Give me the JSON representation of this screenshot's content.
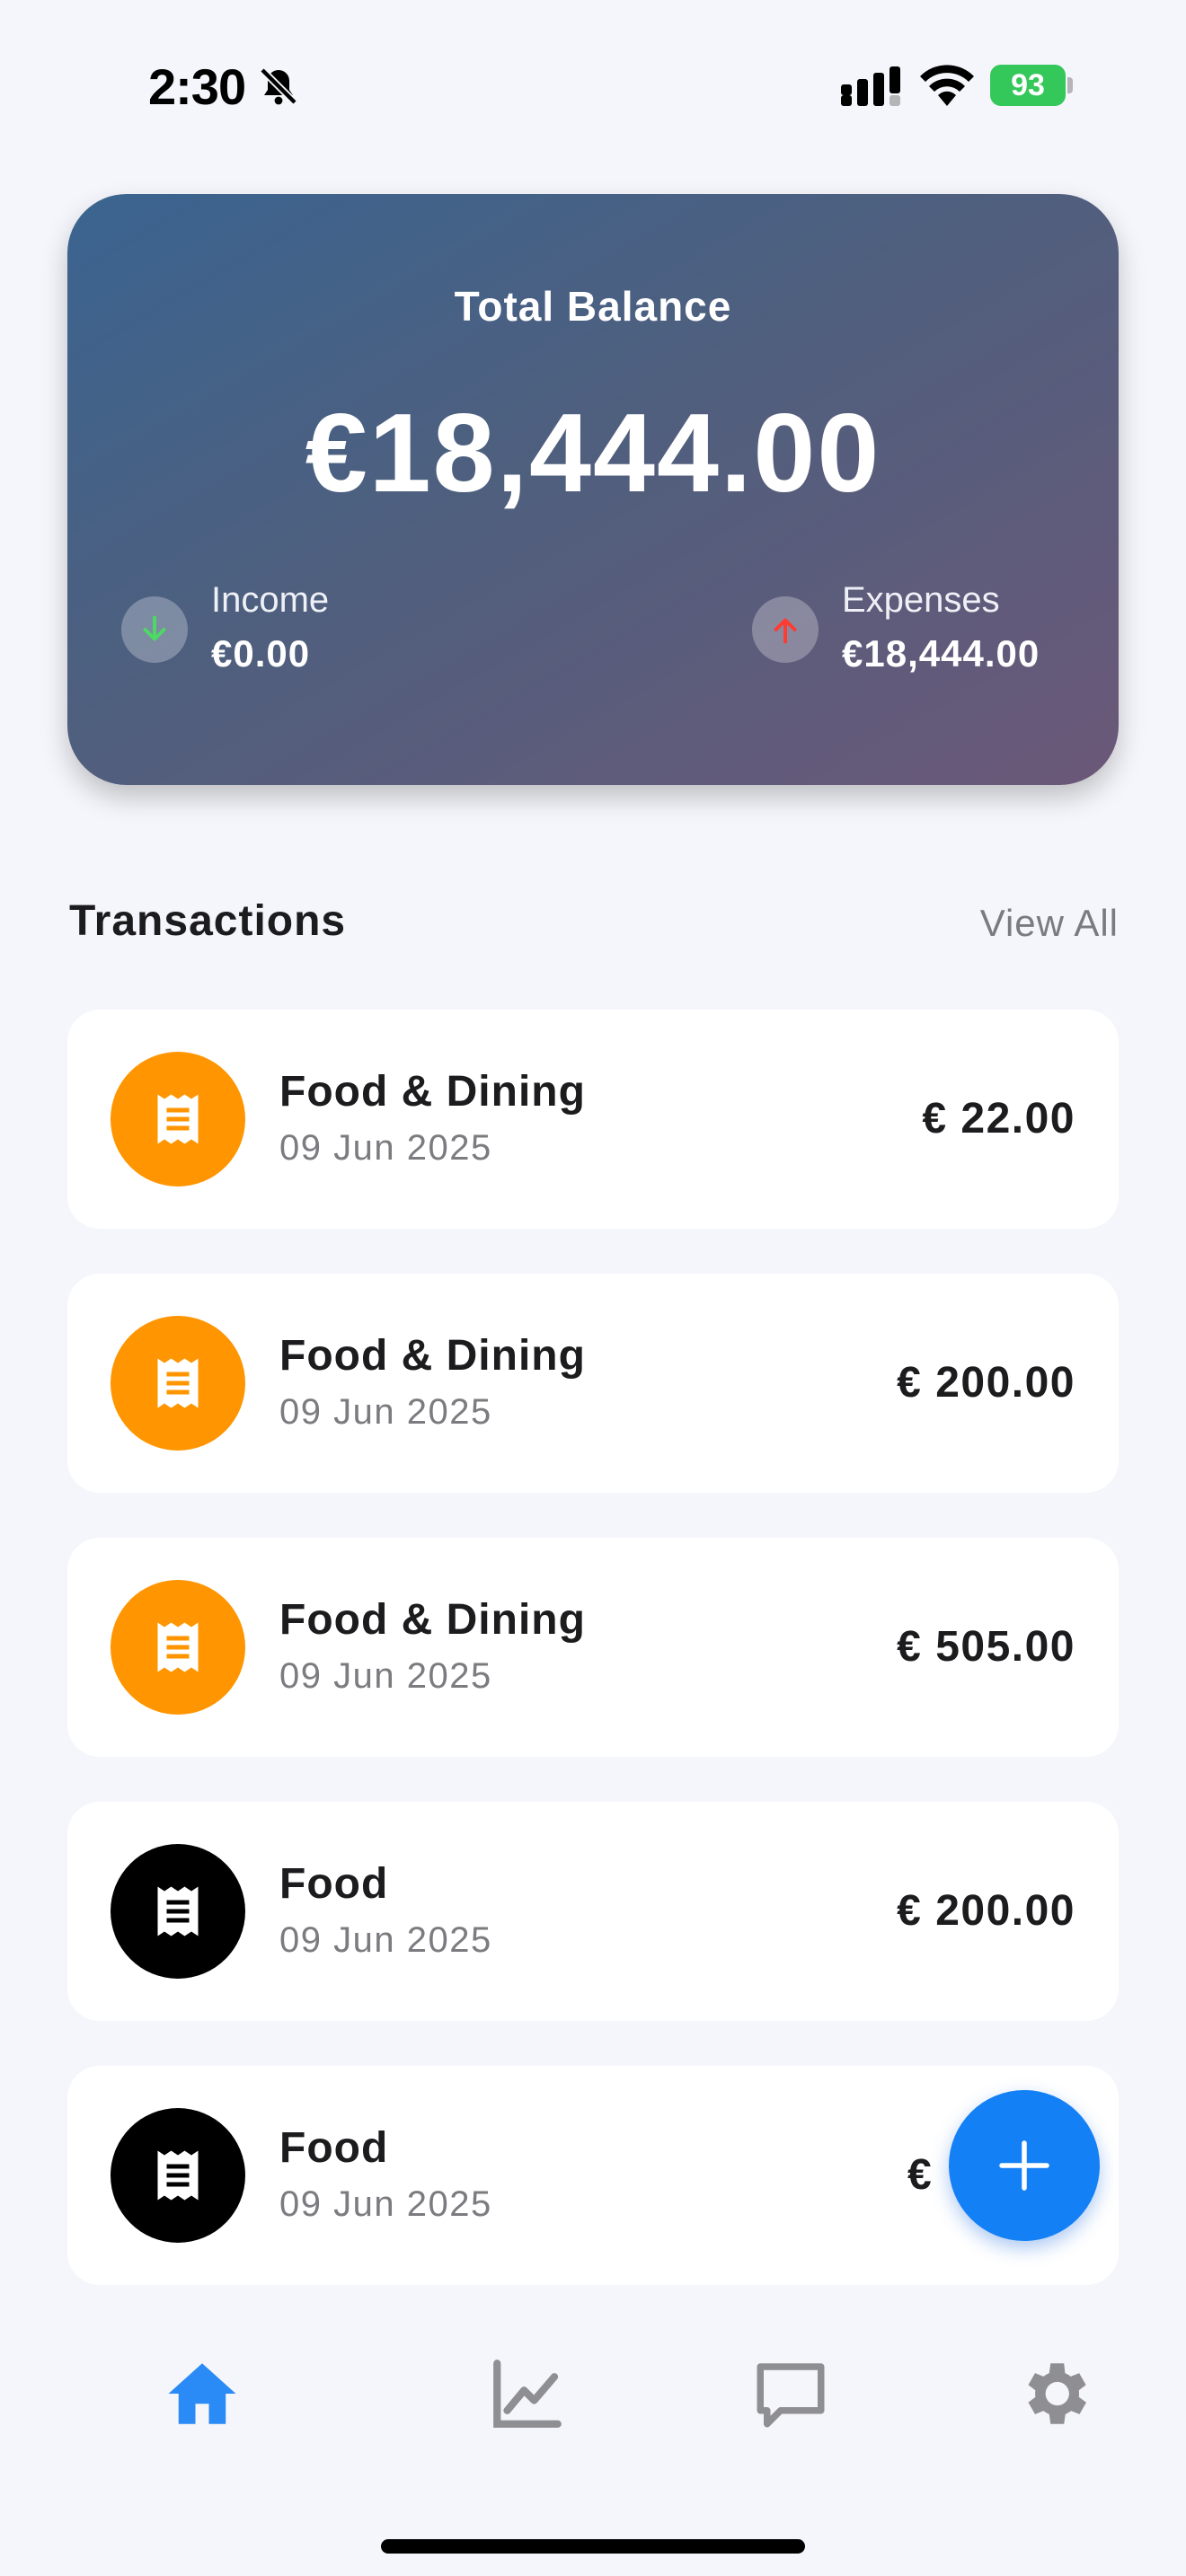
{
  "status_bar": {
    "time": "2:30",
    "battery": "93",
    "icons": [
      "bell-off-icon",
      "signal-icon",
      "wifi-icon",
      "battery-icon"
    ]
  },
  "balance_card": {
    "label": "Total Balance",
    "amount": "€18,444.00",
    "income": {
      "label": "Income",
      "value": "€0.00",
      "icon": "arrow-down-icon"
    },
    "expenses": {
      "label": "Expenses",
      "value": "€18,444.00",
      "icon": "arrow-up-icon"
    }
  },
  "transactions_section": {
    "title": "Transactions",
    "view_all": "View All"
  },
  "transactions": [
    {
      "name": "Food & Dining",
      "date": "09 Jun 2025",
      "amount": "€ 22.00",
      "icon": "receipt-icon",
      "icon_color": "#ff9500"
    },
    {
      "name": "Food & Dining",
      "date": "09 Jun 2025",
      "amount": "€ 200.00",
      "icon": "receipt-icon",
      "icon_color": "#ff9500"
    },
    {
      "name": "Food & Dining",
      "date": "09 Jun 2025",
      "amount": "€ 505.00",
      "icon": "receipt-icon",
      "icon_color": "#ff9500"
    },
    {
      "name": "Food",
      "date": "09 Jun 2025",
      "amount": "€ 200.00",
      "icon": "receipt-icon",
      "icon_color": "#000000"
    },
    {
      "name": "Food",
      "date": "09 Jun 2025",
      "amount": "€",
      "icon": "receipt-icon",
      "icon_color": "#000000"
    }
  ],
  "fab": {
    "icon": "plus-icon",
    "color": "#1480f5"
  },
  "bottom_nav": {
    "items": [
      {
        "icon": "home-icon",
        "active": true
      },
      {
        "icon": "chart-icon",
        "active": false
      },
      {
        "icon": "chat-icon",
        "active": false
      },
      {
        "icon": "gear-icon",
        "active": false
      }
    ],
    "active_color": "#2a8af6",
    "inactive_color": "#8e8e93"
  }
}
